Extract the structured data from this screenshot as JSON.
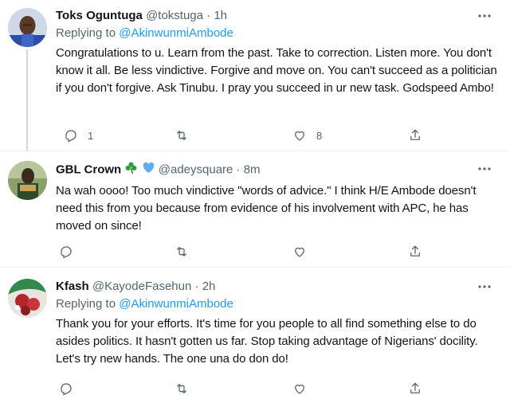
{
  "tweets": [
    {
      "name": "Toks Oguntuga",
      "handle": "@tokstuga",
      "sep": "·",
      "time": "1h",
      "replying_prefix": "Replying to ",
      "replying_to": "@AkinwunmiAmbode",
      "text": "Congratulations to u. Learn from the past. Take to correction. Listen more. You don't know it all. Be less vindictive. Forgive and move on. You can't succeed as a politician if you don't forgive. Ask Tinubu. I pray you succeed in ur new task. Godspeed Ambo!",
      "reply_count": "1",
      "like_count": "8"
    },
    {
      "name": "GBL Crown",
      "emojis": [
        "shamrock-icon",
        "blue-heart-icon"
      ],
      "handle": "@adeysquare",
      "sep": "·",
      "time": "8m",
      "text": "Na wah oooo! Too much vindictive \"words of advice.\" I think H/E Ambode doesn't need this from you because from evidence of his involvement with APC, he has moved on since!"
    },
    {
      "name": "Kfash",
      "handle": "@KayodeFasehun",
      "sep": "·",
      "time": "2h",
      "replying_prefix": "Replying to ",
      "replying_to": "@AkinwunmiAmbode",
      "text": "Thank you for your efforts. It's time for you people to all find something else to do asides politics. It hasn't gotten us far. Stop taking advantage of Nigerians' docility. Let's try new hands. The one una do don do!"
    }
  ],
  "colors": {
    "link": "#1d9bf0",
    "secondary": "#536471",
    "thread_line": "#cfd9de"
  }
}
